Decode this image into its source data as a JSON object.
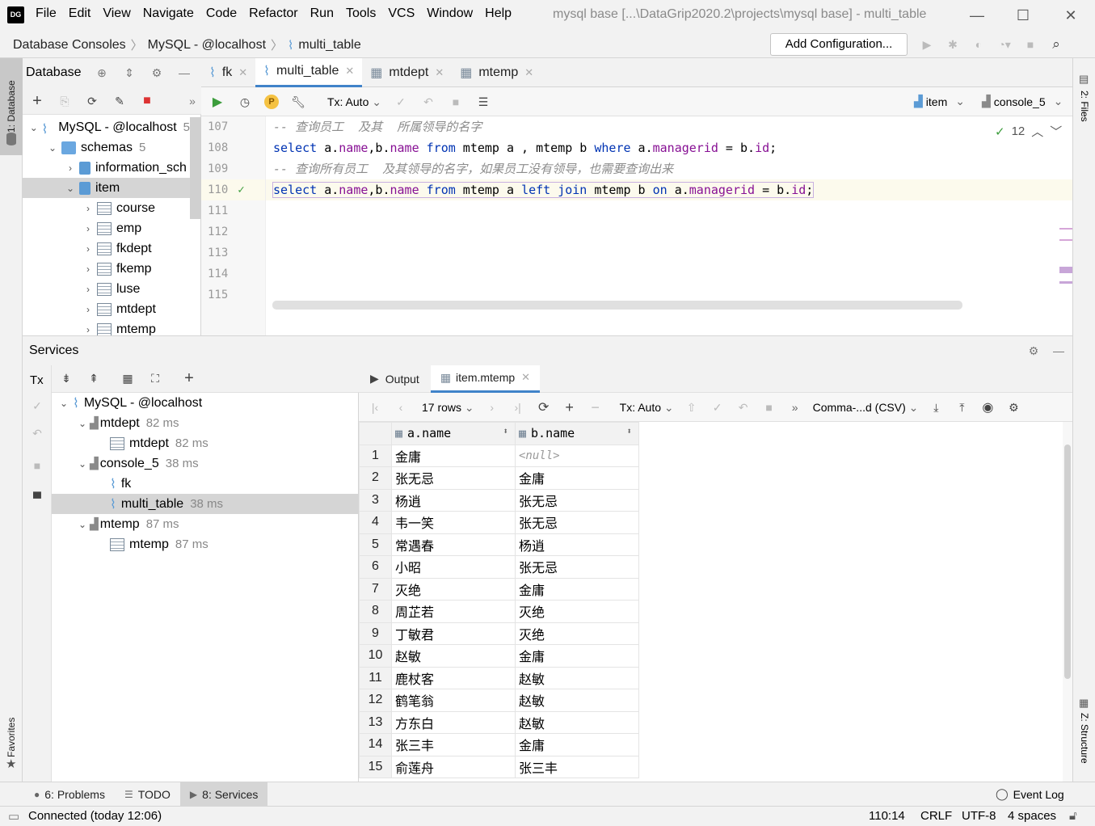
{
  "titlebar": {
    "menu": [
      "File",
      "Edit",
      "View",
      "Navigate",
      "Code",
      "Refactor",
      "Run",
      "Tools",
      "VCS",
      "Window",
      "Help"
    ],
    "window_title": "mysql base [...\\DataGrip2020.2\\projects\\mysql base] - multi_table",
    "logo": "DG"
  },
  "navbar": {
    "crumbs": [
      "Database Consoles",
      "MySQL - @localhost",
      "multi_table"
    ],
    "add_config": "Add Configuration..."
  },
  "left_strip": {
    "database_tab": "1: Database",
    "favorites_tab": "Favorites"
  },
  "right_strip": {
    "files_tab": "2: Files",
    "structure_tab": "Z: Structure"
  },
  "db_panel": {
    "title": "Database",
    "tree": [
      {
        "label": "MySQL - @localhost",
        "level": 0,
        "arrow": "⌄",
        "icon": "mysql",
        "extra": "5"
      },
      {
        "label": "schemas",
        "level": 1,
        "arrow": "⌄",
        "icon": "folder",
        "extra": "5"
      },
      {
        "label": "information_sch",
        "level": 2,
        "arrow": "›",
        "icon": "db",
        "extra": ""
      },
      {
        "label": "item",
        "level": 2,
        "arrow": "⌄",
        "icon": "db",
        "extra": "",
        "selected": true
      },
      {
        "label": "course",
        "level": 3,
        "arrow": "›",
        "icon": "table",
        "extra": ""
      },
      {
        "label": "emp",
        "level": 3,
        "arrow": "›",
        "icon": "table",
        "extra": ""
      },
      {
        "label": "fkdept",
        "level": 3,
        "arrow": "›",
        "icon": "table",
        "extra": ""
      },
      {
        "label": "fkemp",
        "level": 3,
        "arrow": "›",
        "icon": "table",
        "extra": ""
      },
      {
        "label": "luse",
        "level": 3,
        "arrow": "›",
        "icon": "table",
        "extra": ""
      },
      {
        "label": "mtdept",
        "level": 3,
        "arrow": "›",
        "icon": "table",
        "extra": ""
      },
      {
        "label": "mtemp",
        "level": 3,
        "arrow": "›",
        "icon": "table",
        "extra": ""
      }
    ]
  },
  "editor": {
    "tabs": [
      {
        "label": "fk",
        "active": false
      },
      {
        "label": "multi_table",
        "active": true
      },
      {
        "label": "mtdept",
        "active": false
      },
      {
        "label": "mtemp",
        "active": false
      }
    ],
    "tx": "Tx: Auto",
    "schema": "item",
    "console": "console_5",
    "inspections": "12",
    "lines": [
      {
        "n": "107",
        "type": "comment",
        "text": "-- 查询员工  及其  所属领导的名字"
      },
      {
        "n": "108",
        "type": "sql1"
      },
      {
        "n": "109",
        "type": "comment",
        "text": "-- 查询所有员工  及其领导的名字，如果员工没有领导，也需要查询出来"
      },
      {
        "n": "110",
        "type": "sql2",
        "current": true
      },
      {
        "n": "111",
        "type": "empty"
      },
      {
        "n": "112",
        "type": "empty"
      },
      {
        "n": "113",
        "type": "empty"
      },
      {
        "n": "114",
        "type": "empty"
      },
      {
        "n": "115",
        "type": "empty"
      }
    ],
    "sql1": [
      "select",
      " a.",
      "name",
      ",b.",
      "name",
      " ",
      "from",
      " mtemp a , mtemp b ",
      "where",
      " a.",
      "managerid",
      " = b.",
      "id",
      ";"
    ],
    "sql2": [
      "select",
      " a.",
      "name",
      ",b.",
      "name",
      " ",
      "from",
      " mtemp a ",
      "left join",
      " mtemp b ",
      "on",
      " a.",
      "managerid",
      " = b.",
      "id",
      ";"
    ]
  },
  "services": {
    "title": "Services",
    "tx_label": "Tx",
    "tree": [
      {
        "label": "MySQL - @localhost",
        "level": 0,
        "arrow": "⌄",
        "icon": "mysql",
        "time": ""
      },
      {
        "label": "mtdept",
        "level": 1,
        "arrow": "⌄",
        "icon": "session",
        "time": "82 ms"
      },
      {
        "label": "mtdept",
        "level": 2,
        "arrow": "",
        "icon": "table",
        "time": "82 ms"
      },
      {
        "label": "console_5",
        "level": 1,
        "arrow": "⌄",
        "icon": "session",
        "time": "38 ms"
      },
      {
        "label": "fk",
        "level": 2,
        "arrow": "",
        "icon": "console",
        "time": ""
      },
      {
        "label": "multi_table",
        "level": 2,
        "arrow": "",
        "icon": "console",
        "time": "38 ms",
        "selected": true
      },
      {
        "label": "mtemp",
        "level": 1,
        "arrow": "⌄",
        "icon": "session",
        "time": "87 ms"
      },
      {
        "label": "mtemp",
        "level": 2,
        "arrow": "",
        "icon": "table",
        "time": "87 ms"
      }
    ]
  },
  "results": {
    "tabs": [
      "Output",
      "item.mtemp"
    ],
    "rows_label": "17 rows",
    "tx": "Tx: Auto",
    "format": "Comma-...d (CSV)",
    "columns": [
      "a.name",
      "b.name"
    ],
    "rows": [
      [
        "1",
        "金庸",
        null
      ],
      [
        "2",
        "张无忌",
        "金庸"
      ],
      [
        "3",
        "杨逍",
        "张无忌"
      ],
      [
        "4",
        "韦一笑",
        "张无忌"
      ],
      [
        "5",
        "常遇春",
        "杨逍"
      ],
      [
        "6",
        "小昭",
        "张无忌"
      ],
      [
        "7",
        "灭绝",
        "金庸"
      ],
      [
        "8",
        "周芷若",
        "灭绝"
      ],
      [
        "9",
        "丁敏君",
        "灭绝"
      ],
      [
        "10",
        "赵敏",
        "金庸"
      ],
      [
        "11",
        "鹿杖客",
        "赵敏"
      ],
      [
        "12",
        "鹤笔翁",
        "赵敏"
      ],
      [
        "13",
        "方东白",
        "赵敏"
      ],
      [
        "14",
        "张三丰",
        "金庸"
      ],
      [
        "15",
        "俞莲舟",
        "张三丰"
      ]
    ],
    "null_text": "<null>"
  },
  "bottom_tabs": [
    {
      "label": "6: Problems",
      "active": false
    },
    {
      "label": "TODO",
      "active": false
    },
    {
      "label": "8: Services",
      "active": true
    }
  ],
  "event_log": "Event Log",
  "status": {
    "left": "Connected (today 12:06)",
    "position": "110:14",
    "line_sep": "CRLF",
    "encoding": "UTF-8",
    "indent": "4 spaces"
  }
}
